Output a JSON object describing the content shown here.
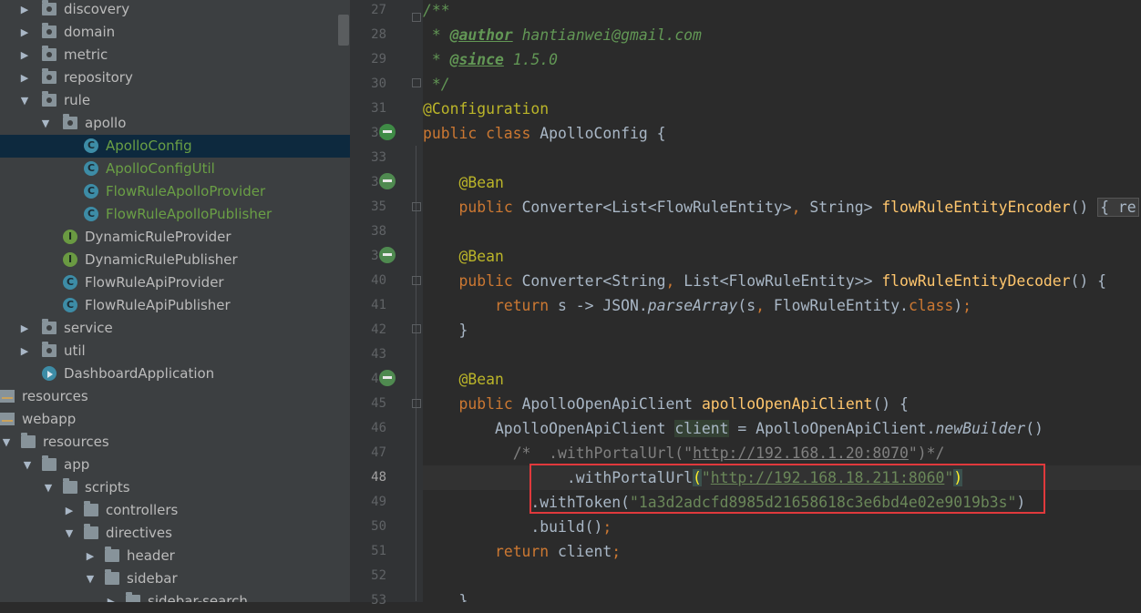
{
  "tree": {
    "items": [
      {
        "label": "discovery",
        "type": "package",
        "arrow": "▶"
      },
      {
        "label": "domain",
        "type": "package",
        "arrow": "▶"
      },
      {
        "label": "metric",
        "type": "package",
        "arrow": "▶"
      },
      {
        "label": "repository",
        "type": "package",
        "arrow": "▶"
      },
      {
        "label": "rule",
        "type": "package",
        "arrow": "▼"
      },
      {
        "label": "apollo",
        "type": "package",
        "arrow": "▼"
      },
      {
        "label": "ApolloConfig",
        "type": "class-new",
        "selected": true
      },
      {
        "label": "ApolloConfigUtil",
        "type": "class-new"
      },
      {
        "label": "FlowRuleApolloProvider",
        "type": "class-new"
      },
      {
        "label": "FlowRuleApolloPublisher",
        "type": "class-new"
      },
      {
        "label": "DynamicRuleProvider",
        "type": "interface"
      },
      {
        "label": "DynamicRulePublisher",
        "type": "interface"
      },
      {
        "label": "FlowRuleApiProvider",
        "type": "class"
      },
      {
        "label": "FlowRuleApiPublisher",
        "type": "class"
      },
      {
        "label": "service",
        "type": "package",
        "arrow": "▶"
      },
      {
        "label": "util",
        "type": "package",
        "arrow": "▶"
      },
      {
        "label": "DashboardApplication",
        "type": "app"
      },
      {
        "label": "resources",
        "type": "resources"
      },
      {
        "label": "webapp",
        "type": "resources"
      },
      {
        "label": "resources",
        "type": "folder",
        "arrow": "▼"
      },
      {
        "label": "app",
        "type": "folder",
        "arrow": "▼"
      },
      {
        "label": "scripts",
        "type": "folder",
        "arrow": "▼"
      },
      {
        "label": "controllers",
        "type": "folder",
        "arrow": "▶"
      },
      {
        "label": "directives",
        "type": "folder",
        "arrow": "▼"
      },
      {
        "label": "header",
        "type": "folder",
        "arrow": "▶"
      },
      {
        "label": "sidebar",
        "type": "folder",
        "arrow": "▼"
      },
      {
        "label": "sidebar-search",
        "type": "folder",
        "arrow": "▶"
      }
    ]
  },
  "editor": {
    "file": "ApolloConfig",
    "line_numbers": [
      "27",
      "28",
      "29",
      "30",
      "31",
      "32",
      "33",
      "34",
      "35",
      "38",
      "39",
      "40",
      "41",
      "42",
      "43",
      "44",
      "45",
      "46",
      "47",
      "48",
      "49",
      "50",
      "51",
      "52",
      "53"
    ],
    "current_line": "48",
    "javadoc": {
      "author_tag": "@author",
      "author": "hantianwei@gmail.com",
      "since_tag": "@since",
      "since": "1.5.0"
    },
    "class_annotation": "@Configuration",
    "class_name": "ApolloConfig",
    "bean_annotation": "@Bean",
    "encoder_method": "flowRuleEntityEncoder",
    "decoder_method": "flowRuleEntityDecoder",
    "client_method": "apolloOpenApiClient",
    "commented_portal_url": "http://192.168.1.20:8070",
    "portal_url": "http://192.168.18.211:8060",
    "token": "1a3d2adcfd8985d21658618c3e6bd4e02e9019b3s"
  },
  "colors": {
    "keyword": "#cc7832",
    "annotation": "#bbb529",
    "method": "#ffc66d",
    "string": "#6a8759",
    "highlight_box": "#e0393c"
  }
}
